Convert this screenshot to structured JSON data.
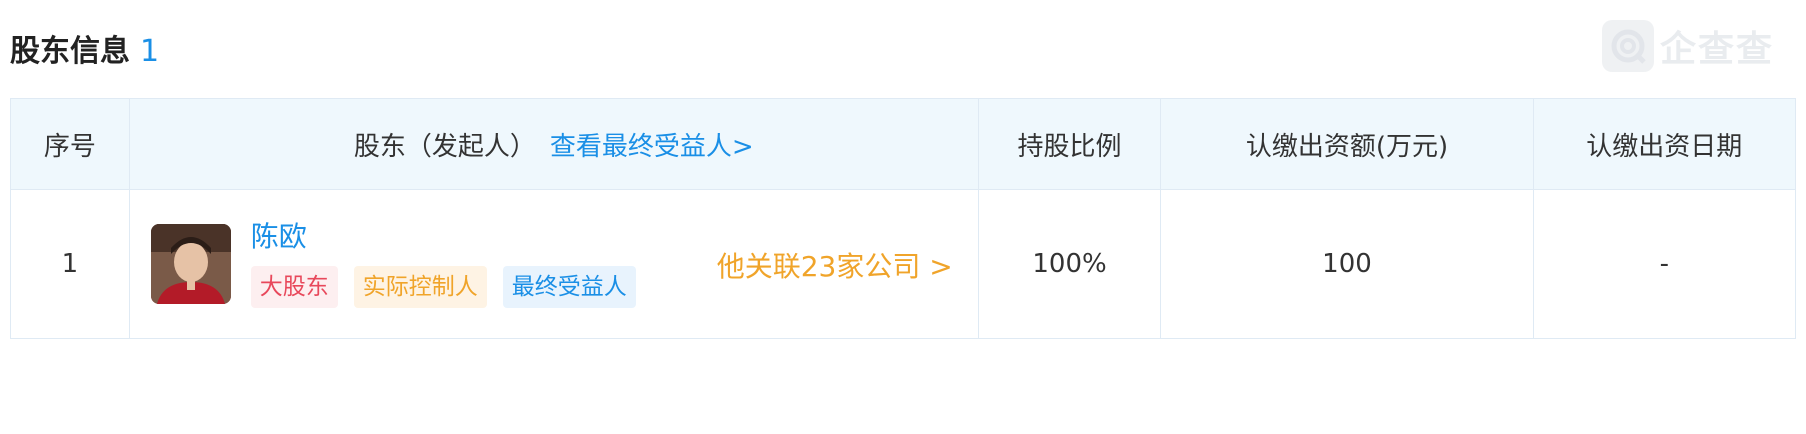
{
  "section": {
    "title": "股东信息",
    "count": "1"
  },
  "watermark": {
    "text": "企查查"
  },
  "table": {
    "headers": {
      "index": "序号",
      "holder": "股东（发起人）",
      "holder_link": "查看最终受益人>",
      "ratio": "持股比例",
      "amount": "认缴出资额(万元)",
      "date": "认缴出资日期"
    },
    "rows": [
      {
        "index": "1",
        "name": "陈欧",
        "tags": [
          "大股东",
          "实际控制人",
          "最终受益人"
        ],
        "related": "他关联23家公司 >",
        "ratio": "100%",
        "amount": "100",
        "date": "-"
      }
    ]
  },
  "colors": {
    "accent_blue": "#1a8fe6",
    "accent_orange": "#f0a42a",
    "tag_red": "#e8485b",
    "header_bg": "#eff8fd"
  }
}
